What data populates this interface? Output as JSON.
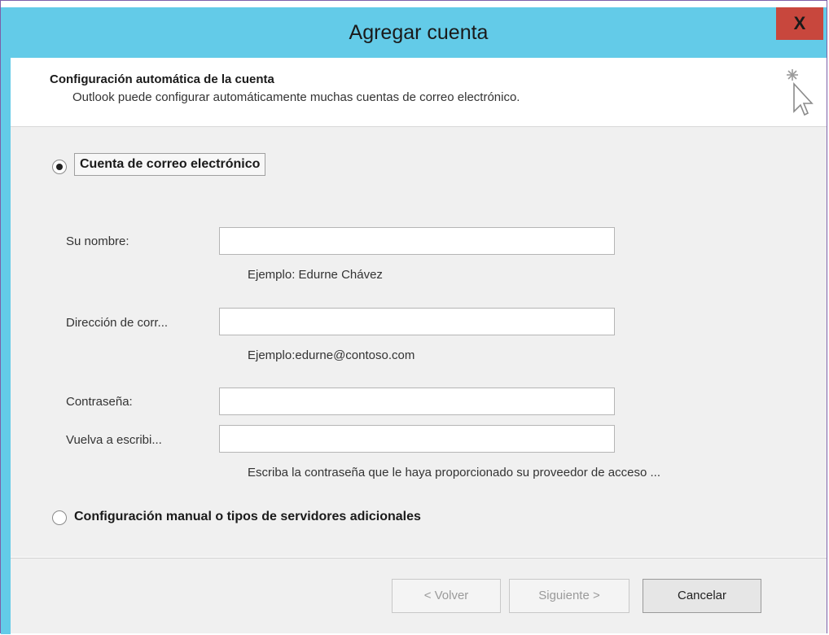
{
  "window": {
    "title": "Agregar cuenta",
    "close_label": "X"
  },
  "header": {
    "title": "Configuración automática de la cuenta",
    "subtitle": "Outlook puede configurar automáticamente muchas cuentas de correo electrónico."
  },
  "options": {
    "email_account_label": "Cuenta de correo electrónico",
    "email_account_selected": true,
    "manual_config_label": "Configuración manual o tipos de servidores adicionales",
    "manual_config_selected": false
  },
  "form": {
    "name_label": "Su nombre:",
    "name_value": "",
    "name_hint": "Ejemplo: Edurne Chávez",
    "email_label": "Dirección de corr...",
    "email_value": "",
    "email_hint": "Ejemplo:edurne@contoso.com",
    "password_label": "Contraseña:",
    "password_value": "",
    "retype_label": "Vuelva a escribi...",
    "retype_value": "",
    "password_hint": "Escriba la contraseña que le haya proporcionado su proveedor de acceso ..."
  },
  "footer": {
    "back_label": "< Volver",
    "next_label": "Siguiente >",
    "cancel_label": "Cancelar"
  },
  "colors": {
    "titlebar": "#63cbe8",
    "close_button": "#c8473d",
    "body_background": "#f0f0f0"
  },
  "icons": {
    "header_icon": "sparkle-cursor-icon"
  }
}
